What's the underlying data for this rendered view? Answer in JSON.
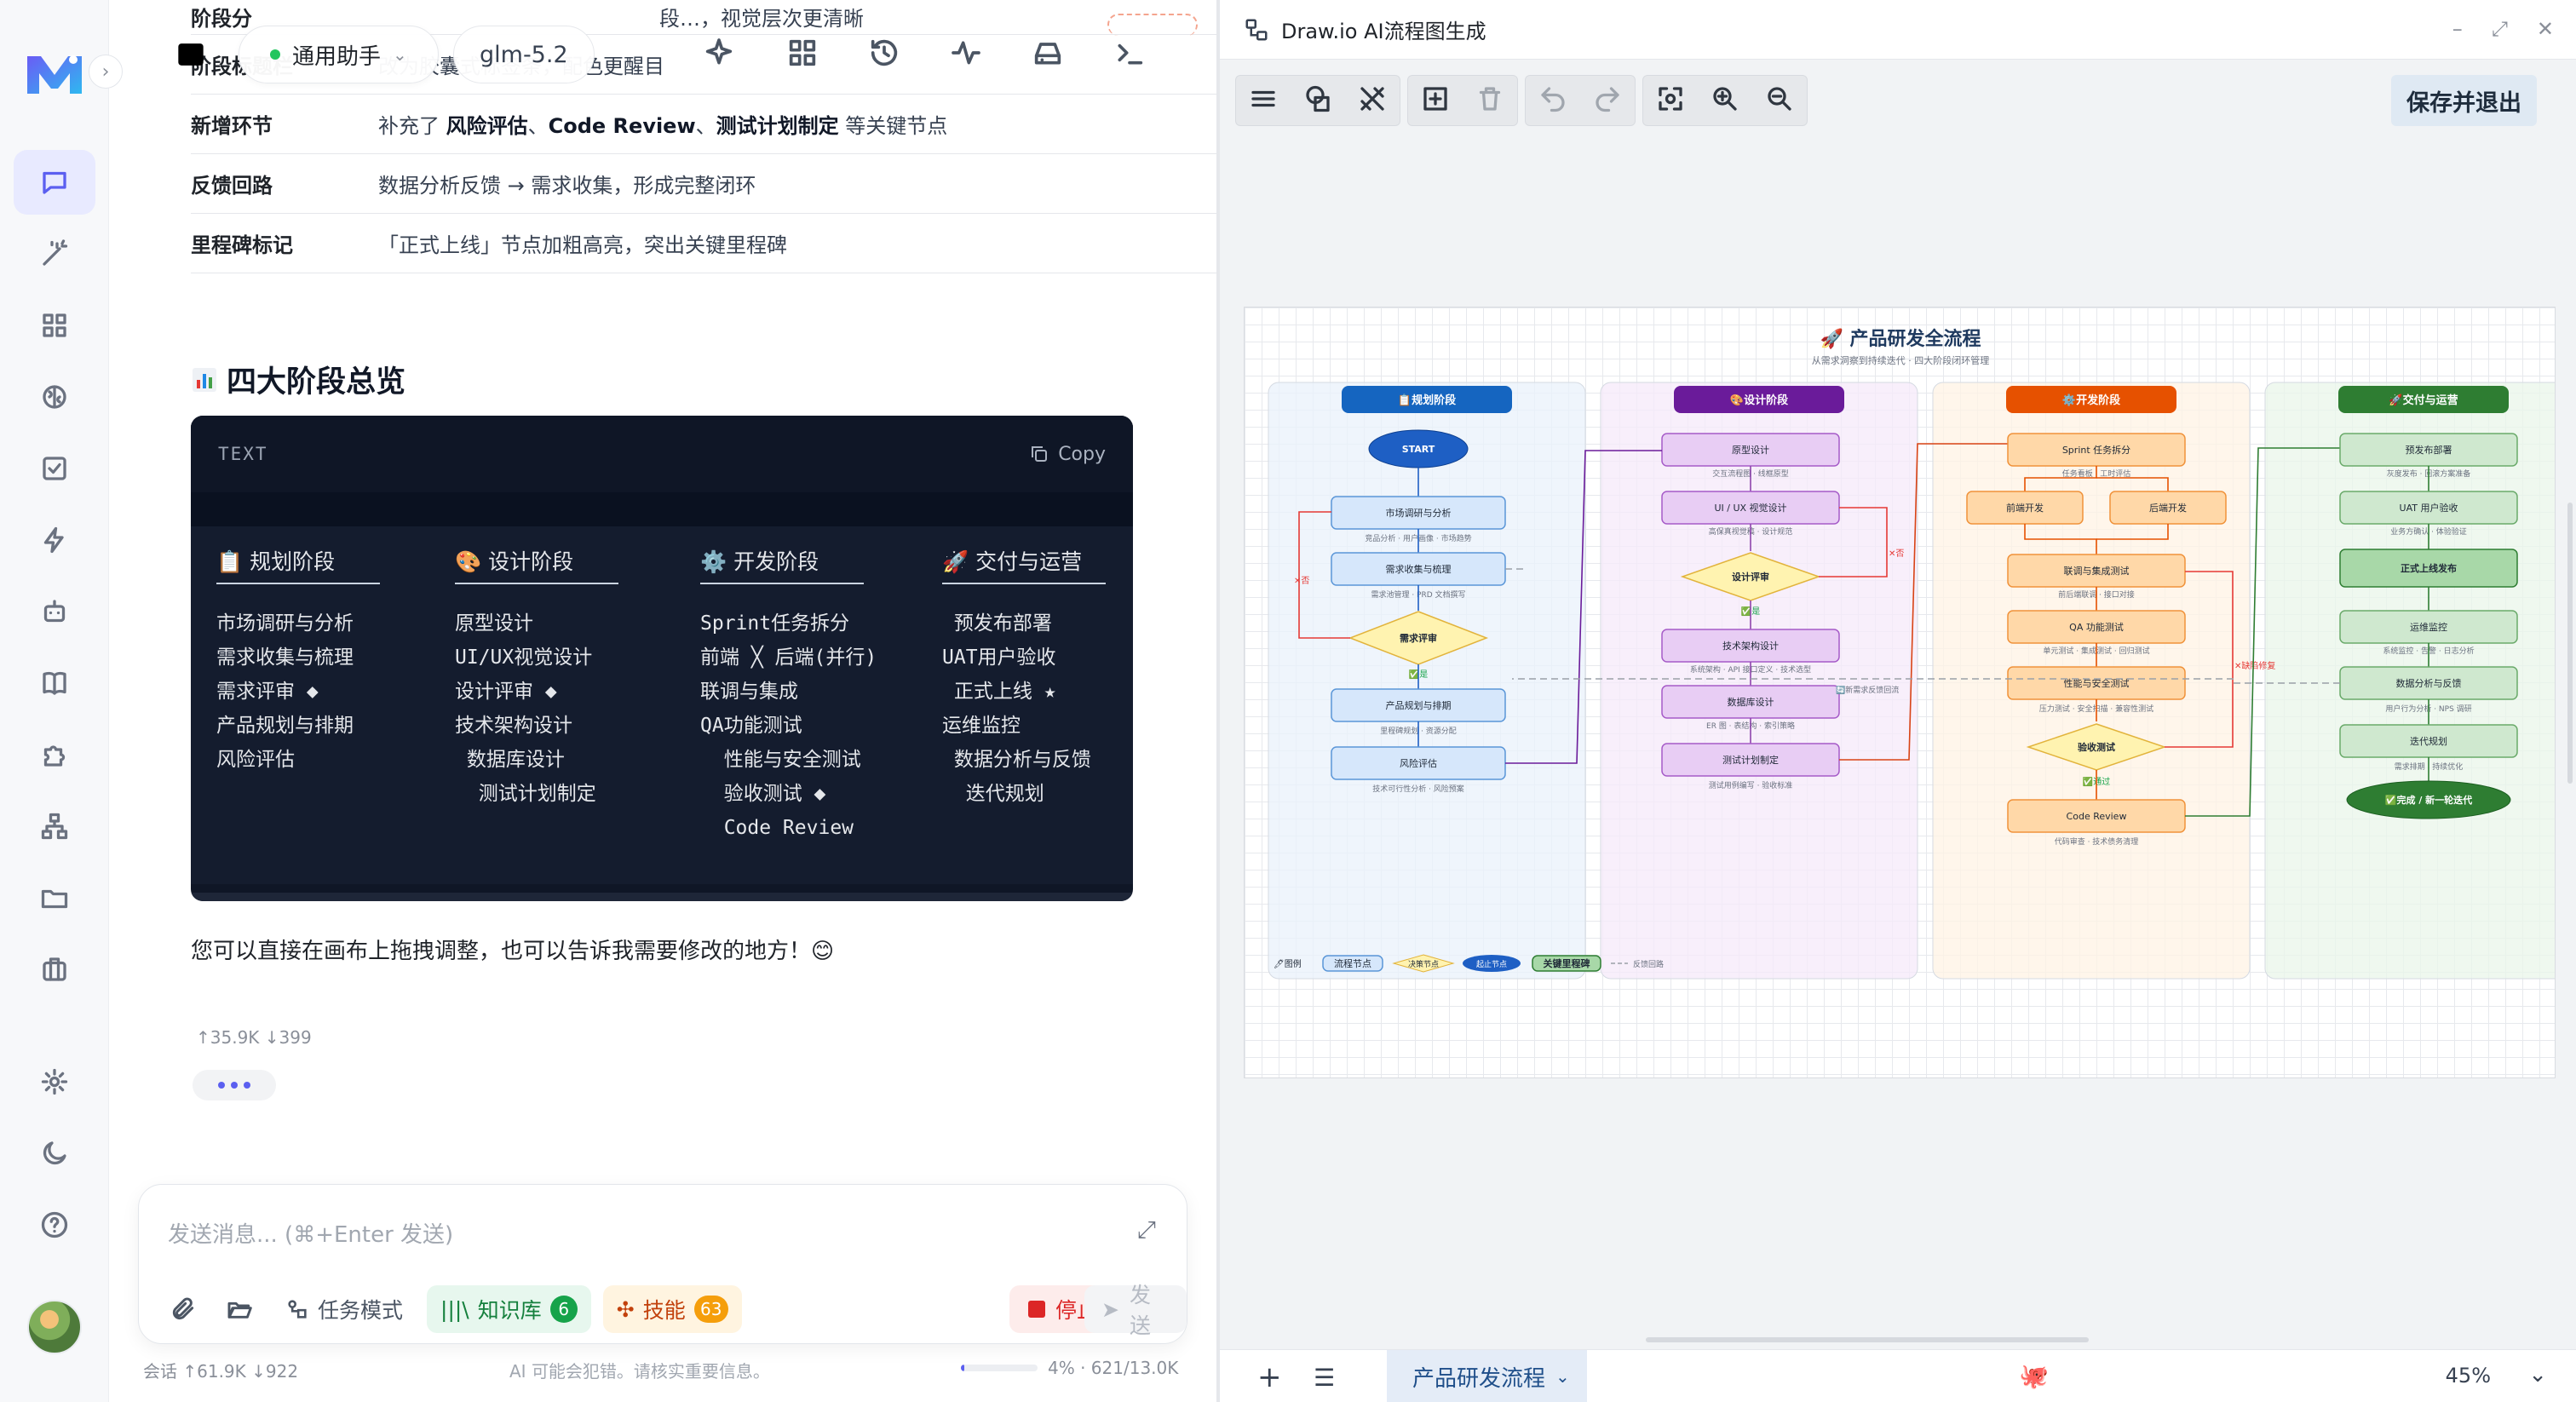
{
  "rail": {
    "items": [
      "chat",
      "magic",
      "apps",
      "brain",
      "tasks",
      "flash",
      "bot",
      "book",
      "puzzle",
      "sitemap",
      "folder",
      "toolbox"
    ],
    "bottom": [
      "settings",
      "theme",
      "help"
    ]
  },
  "chat": {
    "assistant_label": "通用助手",
    "model_label": "glm-5.2",
    "table": [
      {
        "key": "阶段分",
        "value_parts": [
          {
            "t": "段…，视觉层次更清晰",
            "b": false
          }
        ]
      },
      {
        "key": "阶段标题栏",
        "value_parts": [
          {
            "t": "改为胶囊式标签条，配色更醒目",
            "b": false
          }
        ]
      },
      {
        "key": "新增环节",
        "value_parts": [
          {
            "t": "补充了 ",
            "b": false
          },
          {
            "t": "风险评估",
            "b": true
          },
          {
            "t": "、",
            "b": false
          },
          {
            "t": "Code Review",
            "b": true
          },
          {
            "t": "、",
            "b": false
          },
          {
            "t": "测试计划制定",
            "b": true
          },
          {
            "t": " 等关键节点",
            "b": false
          }
        ]
      },
      {
        "key": "反馈回路",
        "value_parts": [
          {
            "t": "数据分析反馈 → 需求收集，形成完整闭环",
            "b": false
          }
        ]
      },
      {
        "key": "里程碑标记",
        "value_parts": [
          {
            "t": "「正式上线」节点加粗高亮，突出关键里程碑",
            "b": false
          }
        ]
      }
    ],
    "section_title": "四大阶段总览",
    "code": {
      "lang": "TEXT",
      "copy_label": "Copy",
      "columns": [
        {
          "icon": "📋",
          "title": "规划阶段",
          "lines": [
            "市场调研与分析",
            "需求收集与梳理",
            "需求评审 ◆",
            "产品规划与排期",
            "风险评估"
          ]
        },
        {
          "icon": "🎨",
          "title": "设计阶段",
          "lines": [
            "原型设计",
            "UI/UX视觉设计",
            "设计评审 ◆",
            "技术架构设计",
            " 数据库设计",
            "  测试计划制定"
          ]
        },
        {
          "icon": "⚙️",
          "title": "开发阶段",
          "lines": [
            "Sprint任务拆分",
            "前端 ╳ 后端(并行)",
            "联调与集成",
            "QA功能测试",
            "  性能与安全测试",
            "  验收测试 ◆",
            "  Code Review"
          ]
        },
        {
          "icon": "🚀",
          "title": "交付与运营",
          "lines": [
            " 预发布部署",
            "UAT用户验收",
            " 正式上线 ★",
            "运维监控",
            " 数据分析与反馈",
            "  迭代规划"
          ]
        }
      ]
    },
    "reply": "您可以直接在画布上拖拽调整，也可以告诉我需要修改的地方！😊",
    "msg_stats": "↑35.9K  ↓399",
    "composer": {
      "placeholder": "发送消息... (⌘+Enter 发送)",
      "mode_label": "任务模式",
      "kb_label": "知识库",
      "kb_count": "6",
      "skill_label": "技能",
      "skill_count": "63",
      "stop_label": "停止",
      "send_label": "发送"
    },
    "footer": {
      "stats": "会话  ↑61.9K  ↓922",
      "note": "AI 可能会犯错。请核实重要信息。",
      "context": "4%  · 621/13.0K",
      "context_fraction": 0.04
    }
  },
  "drawio": {
    "window_title": "Draw.io AI流程图生成",
    "save_label": "保存并退出",
    "page_tab": "产品研发流程",
    "zoom": "45%",
    "diagram": {
      "title": "🚀 产品研发全流程",
      "subtitle": "从需求洞察到持续迭代 · 四大阶段闭环管理",
      "lanes": [
        {
          "name": "📋规划阶段",
          "color": "#1565c0",
          "bg": "#e9f1fb",
          "nodes": [
            "START",
            "市场调研与分析",
            "需求收集与梳理",
            "需求评审",
            "产品规划与排期",
            "风险评估"
          ],
          "notes": [
            "竞品分析 · 用户画像 · 市场趋势",
            "需求池管理 · PRD 文档撰写",
            "里程碑规划 · 资源分配",
            "技术可行性分析 · 风险预案"
          ]
        },
        {
          "name": "🎨设计阶段",
          "color": "#6a1b9a",
          "bg": "#f5eafa",
          "nodes": [
            "原型设计",
            "UI / UX 视觉设计",
            "设计评审",
            "技术架构设计",
            "数据库设计",
            "测试计划制定"
          ],
          "notes": [
            "交互流程图 · 线框原型",
            "高保真视觉稿 · 设计规范",
            "系统架构 · API 接口定义 · 技术选型",
            "ER 图 · 表结构 · 索引策略",
            "测试用例编写 · 验收标准"
          ]
        },
        {
          "name": "⚙️开发阶段",
          "color": "#e65100",
          "bg": "#fff3e4",
          "nodes": [
            "Sprint 任务拆分",
            "前端开发",
            "后端开发",
            "联调与集成测试",
            "QA 功能测试",
            "性能与安全测试",
            "验收测试",
            "Code Review"
          ],
          "notes": [
            "任务看板 · 工时评估",
            "前后端联调 · 接口对接",
            "单元测试 · 集成测试 · 回归测试",
            "压力测试 · 安全扫描 · 兼容性测试",
            "代码审查 · 技术债务清理"
          ]
        },
        {
          "name": "🚀交付与运营",
          "color": "#2e7d32",
          "bg": "#eaf5ea",
          "nodes": [
            "预发布部署",
            "UAT 用户验收",
            "正式上线发布",
            "运维监控",
            "数据分析与反馈",
            "迭代规划",
            "✅完成 / 新一轮迭代"
          ],
          "notes": [
            "灰度发布 · 回滚方案准备",
            "业务方确认 · 体验验证",
            "系统监控 · 告警 · 日志分析",
            "用户行为分析 · NPS 调研",
            "需求排期 · 持续优化"
          ]
        }
      ],
      "edge_labels": {
        "yes": "是",
        "no": "否",
        "pass": "通过",
        "fail": "缺陷修复",
        "loop": "新需求反馈回流"
      },
      "legend": [
        "图例",
        "流程节点",
        "决策节点",
        "起止节点",
        "关键里程碑",
        "反馈回路"
      ]
    }
  }
}
